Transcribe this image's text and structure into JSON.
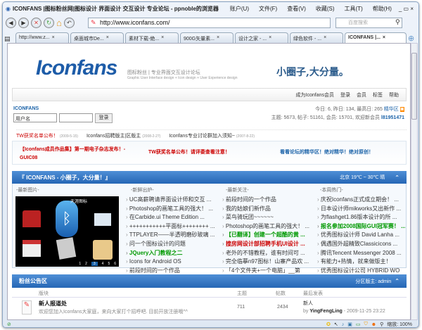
{
  "browser": {
    "title": "ICONFANS |图标粉丝网|图标设计 界面设计 交互设计 专业论坛 - ppnoble的浏览器",
    "menu": [
      "账户(U)",
      "文件(F)",
      "查看(V)",
      "收藏(S)",
      "工具(T)",
      "帮助(H)"
    ],
    "url": "http://www.iconfans.com/",
    "search_placeholder": "百度搜索",
    "tabs": [
      "http://www.z...",
      "桌面城市De...",
      "素材下载-绝...",
      "900G矢量素...",
      "设计之家 - ...",
      "绿色软件 - ...",
      "ICONFANS |..."
    ],
    "zoom": "缩放: 100%"
  },
  "header": {
    "logo": "Iconfans",
    "slogan_cn": "图标粉丝 | 专业界面交互设计论坛",
    "slogan_en": "Graphic User Interface design + Icon design + User Experience design",
    "motto": "小圈子,大分量。",
    "nav": [
      "成为Iconfans会员",
      "登录",
      "会员",
      "标签",
      "帮助"
    ]
  },
  "login": {
    "site": "ICONFANS",
    "username_placeholder": "用户名",
    "button": "登录"
  },
  "stats": {
    "line1": "今日: 6, 昨日: 134, 最高日: 265",
    "digest": "精华区",
    "line2": "主题: 5673, 帖子: 51161, 会员: 15701, 欢迎新会员",
    "new_member": "l81951471"
  },
  "notices": [
    {
      "title": "TW获奖名单公布！",
      "date": "(2009-5-15)"
    },
    {
      "title": "Iconfans招聘版主|区版主",
      "date": "(2008-2-27)"
    },
    {
      "title": "Iconfans专业讨论群加入须知~",
      "date": "(2007-8-22)"
    }
  ],
  "banner": [
    "【Iconfans成员作品集】第一期电子杂志发布！- GUIC08",
    "TW获奖名单公布！请评委查看注意！",
    "看看论坛的精华区！绝对精华！绝对原创！"
  ],
  "section1": {
    "title": "『 ICONFANS - 小圈子，大分量！』",
    "weather": "北京 19℃ ~ 30℃ 晴",
    "columns": [
      "-最新图片-",
      "-新鲜出炉-",
      "-最新关注-",
      "-本周热门-"
    ],
    "pager": [
      "1",
      "2",
      "3",
      "4",
      "5",
      "6"
    ],
    "image_caption": "天涯图标",
    "new": [
      "UC高薪聘请界面设计师和交互 ...",
      "Photoshop的画笔工具的强大！ ...",
      "在Carbide.ui Theme Edition ...",
      "+++++++++++平面标++++++++ ...",
      "TTPLAYER——半透明磨砂玻璃 ...",
      "问一个图标设计的问题",
      "JQuery入门教程之二",
      "Icons for Android OS",
      "前段时间的一个作品"
    ],
    "focus": [
      "前段时间的一个作品",
      "我的姑娘们新作品",
      "菜鸟骑玩团~~~~~~",
      "Photoshop的画笔工具的强大！ ...",
      "【已翻译】创建一个超酷的黄 ...",
      "搜房网设计部招聘手机UI设计 ...",
      "老外的不错教程，谁有时间可 ...",
      "完全临摹n97图标！山寨产品欢 ...",
      "「4个文件夹+一个电脑」__第"
    ],
    "hot": [
      "庆祝Iconfans正式成立期会！ ...",
      "日本设计师mikworks又出新作 ...",
      "为flashget1.86版本设计的所 ...",
      "报名参加2008国际GUI冠军赛！ ...",
      "优秀图标设计师 David Lanha ...",
      "偶遇国外超精致Classicicons ...",
      "腾讯Tencent Messenger 2008 ...",
      "有能力+热情，就来做版主！",
      "优秀图标设计公司 HYBRID WO"
    ]
  },
  "section2": {
    "title": "粉丝公告区",
    "moderator": "分区版主: admin",
    "headers": [
      "版块",
      "主题",
      "帖数",
      "最后发表"
    ],
    "rows": [
      {
        "name": "新人报道处",
        "desc": "欢迎您加入Iconfans大家庭，来向大家打个招呼吧. 目前开放注册哦^^",
        "topics": "711",
        "posts": "2434",
        "last_title": "新人",
        "last_by": "by",
        "last_user": "YingFengLing",
        "last_time": "- 2009-11-25 23:22"
      }
    ]
  }
}
